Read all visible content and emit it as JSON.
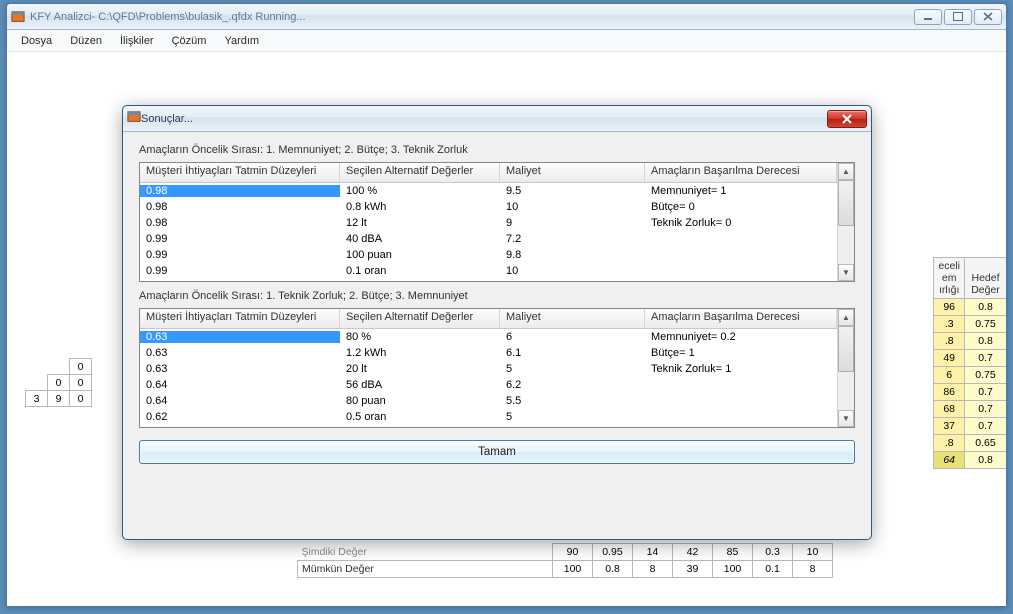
{
  "main": {
    "title": "KFY Analizci- C:\\QFD\\Problems\\bulasik_.qfdx Running...",
    "menu": [
      "Dosya",
      "Düzen",
      "İlişkiler",
      "Çözüm",
      "Yardım"
    ]
  },
  "bg_right": {
    "headers": [
      "eceli\nem\nırlığı",
      "Hedef\nDeğer"
    ],
    "rows": [
      [
        "96",
        "0.8"
      ],
      [
        ".3",
        "0.75"
      ],
      [
        ".8",
        "0.8"
      ],
      [
        "49",
        "0.7"
      ],
      [
        "6",
        "0.75"
      ],
      [
        "86",
        "0.7"
      ],
      [
        "68",
        "0.7"
      ],
      [
        "37",
        "0.7"
      ],
      [
        ".8",
        "0.65"
      ],
      [
        "64",
        "0.8"
      ]
    ]
  },
  "bg_left": {
    "rows": [
      [
        "",
        "0"
      ],
      [
        "0",
        "0"
      ],
      [
        "3  9",
        "0"
      ]
    ],
    "col3": "3",
    "colmid": [
      "0",
      "0",
      "0"
    ],
    "colright": [
      "",
      "",
      ""
    ],
    "leadcell": "3",
    "pair": [
      "0",
      "9"
    ]
  },
  "bg_bottom": {
    "rows": [
      {
        "label": "Şimdiki Değer",
        "vals": [
          "90",
          "0.95",
          "14",
          "42",
          "85",
          "0.3",
          "10"
        ]
      },
      {
        "label": "Mümkün Değer",
        "vals": [
          "100",
          "0.8",
          "8",
          "39",
          "100",
          "0.1",
          "8"
        ]
      }
    ]
  },
  "dialog": {
    "title": "Sonuçlar...",
    "section1_label": "Amaçların Öncelik Sırası: 1. Memnuniyet; 2. Bütçe; 3. Teknik Zorluk",
    "section2_label": "Amaçların Öncelik Sırası: 1. Teknik Zorluk; 2. Bütçe; 3. Memnuniyet",
    "columns": [
      "Müşteri İhtiyaçları Tatmin Düzeyleri",
      "Seçilen Alternatif Değerler",
      "Maliyet",
      "Amaçların Başarılma Derecesi"
    ],
    "table1": [
      {
        "c0": "0.98",
        "c1": "100 %",
        "c2": "9.5",
        "c3": "Memnuniyet= 1"
      },
      {
        "c0": "0.98",
        "c1": "0.8 kWh",
        "c2": "10",
        "c3": "Bütçe= 0"
      },
      {
        "c0": "0.98",
        "c1": "12 lt",
        "c2": "9",
        "c3": "Teknik Zorluk= 0"
      },
      {
        "c0": "0.99",
        "c1": "40 dBA",
        "c2": "7.2",
        "c3": ""
      },
      {
        "c0": "0.99",
        "c1": "100 puan",
        "c2": "9.8",
        "c3": ""
      },
      {
        "c0": "0.99",
        "c1": "0.1 oran",
        "c2": "10",
        "c3": ""
      }
    ],
    "table2": [
      {
        "c0": "0.63",
        "c1": "80 %",
        "c2": "6",
        "c3": "Memnuniyet= 0.2"
      },
      {
        "c0": "0.63",
        "c1": "1.2 kWh",
        "c2": "6.1",
        "c3": "Bütçe= 1"
      },
      {
        "c0": "0.63",
        "c1": "20 lt",
        "c2": "5",
        "c3": "Teknik Zorluk= 1"
      },
      {
        "c0": "0.64",
        "c1": "56 dBA",
        "c2": "6.2",
        "c3": ""
      },
      {
        "c0": "0.64",
        "c1": "80 puan",
        "c2": "5.5",
        "c3": ""
      },
      {
        "c0": "0.62",
        "c1": "0.5 oran",
        "c2": "5",
        "c3": ""
      }
    ],
    "ok_label": "Tamam"
  }
}
